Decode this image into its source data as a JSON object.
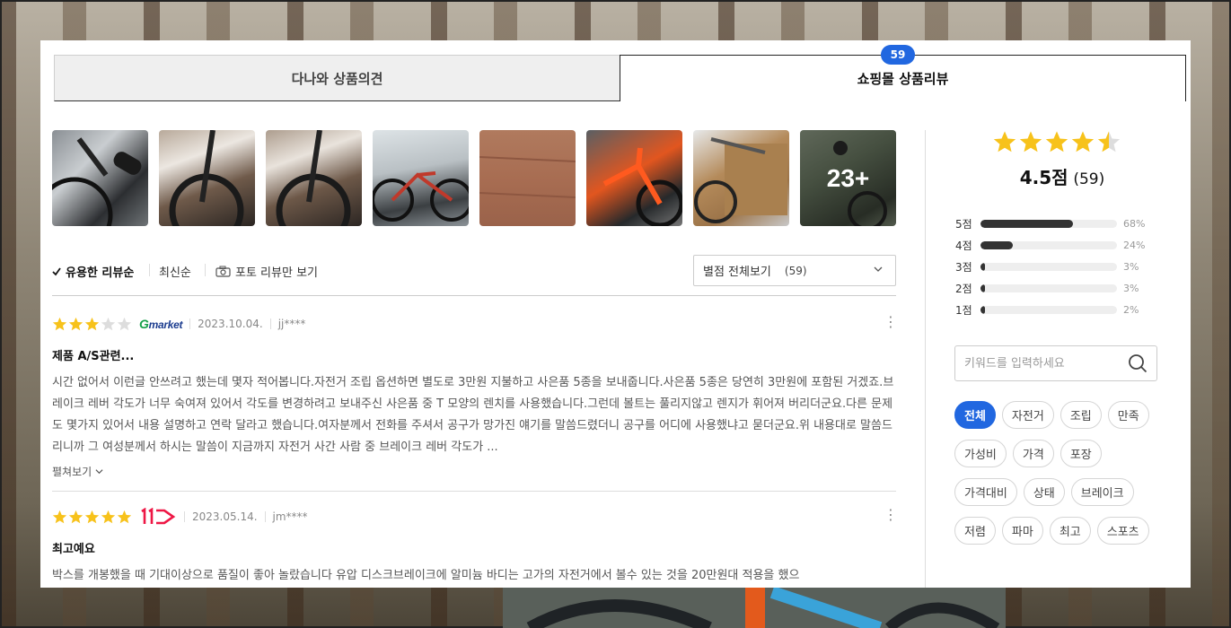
{
  "tabs": {
    "opinion_label": "다나와 상품의견",
    "review_label": "쇼핑몰 상품리뷰",
    "review_badge": "59"
  },
  "photos": {
    "more_label": "23+"
  },
  "sort": {
    "useful_label": "유용한 리뷰순",
    "latest_label": "최신순",
    "photo_label": "포토 리뷰만 보기",
    "filter_label": "별점 전체보기",
    "filter_count": "(59)"
  },
  "reviews": [
    {
      "rating": 3,
      "store": "Gmarket",
      "date": "2023.10.04.",
      "author": "jj****",
      "title": "제품 A/S관련...",
      "body": "시간 없어서 이런글 안쓰려고 했는데 몇자 적어봅니다.자전거 조립 옵션하면 별도로 3만원 지불하고 사은품 5종을 보내줍니다.사은품 5종은 당연히 3만원에 포함된 거겠죠.브레이크 레버 각도가 너무 숙여져 있어서 각도를 변경하려고 보내주신 사은품 중 T 모양의 렌치를 사용했습니다.그런데 볼트는 풀리지않고 렌지가 휘어져 버리더군요.다른 문제도 몇가지 있어서 내용 설명하고 연락 달라고 했습니다.여자분께서 전화를 주셔서 공구가 망가진 얘기를 말씀드렸더니 공구를 어디에 사용했냐고 묻더군요.위 내용대로 말씀드리니까 그 여성분께서 하시는 말씀이 지금까지 자전거 사간 사람 중 브레이크 레버 각도가 ...",
      "expand_label": "펼쳐보기"
    },
    {
      "rating": 5,
      "store": "11번가",
      "date": "2023.05.14.",
      "author": "jm****",
      "title": "최고예요",
      "body": "박스를 개봉했을 때 기대이상으로 품질이 좋아 놀랐습니다 유압 디스크브레이크에 알미늄 바디는 고가의 자전거에서 볼수 있는 것을 20만원대 적용을 했으"
    }
  ],
  "summary": {
    "rating_value": 4.5,
    "score_text": "4.5점",
    "count_text": "(59)",
    "distribution": [
      {
        "label": "5점",
        "pct": 68,
        "pct_text": "68%"
      },
      {
        "label": "4점",
        "pct": 24,
        "pct_text": "24%"
      },
      {
        "label": "3점",
        "pct": 3,
        "pct_text": "3%"
      },
      {
        "label": "2점",
        "pct": 3,
        "pct_text": "3%"
      },
      {
        "label": "1점",
        "pct": 2,
        "pct_text": "2%"
      }
    ]
  },
  "keyword": {
    "placeholder": "키워드를 입력하세요"
  },
  "chips": [
    "전체",
    "자전거",
    "조립",
    "만족",
    "가성비",
    "가격",
    "포장",
    "가격대비",
    "상태",
    "브레이크",
    "저렴",
    "파마",
    "최고",
    "스포츠"
  ],
  "colors": {
    "accent": "#2167e0",
    "star": "#f7c21b",
    "star_empty": "#dddddd",
    "bar_fill": "#333333",
    "gmarket_g": "#16a04a",
    "gmarket_text": "#1b3c8f",
    "eleven_st": "#ee1745"
  }
}
